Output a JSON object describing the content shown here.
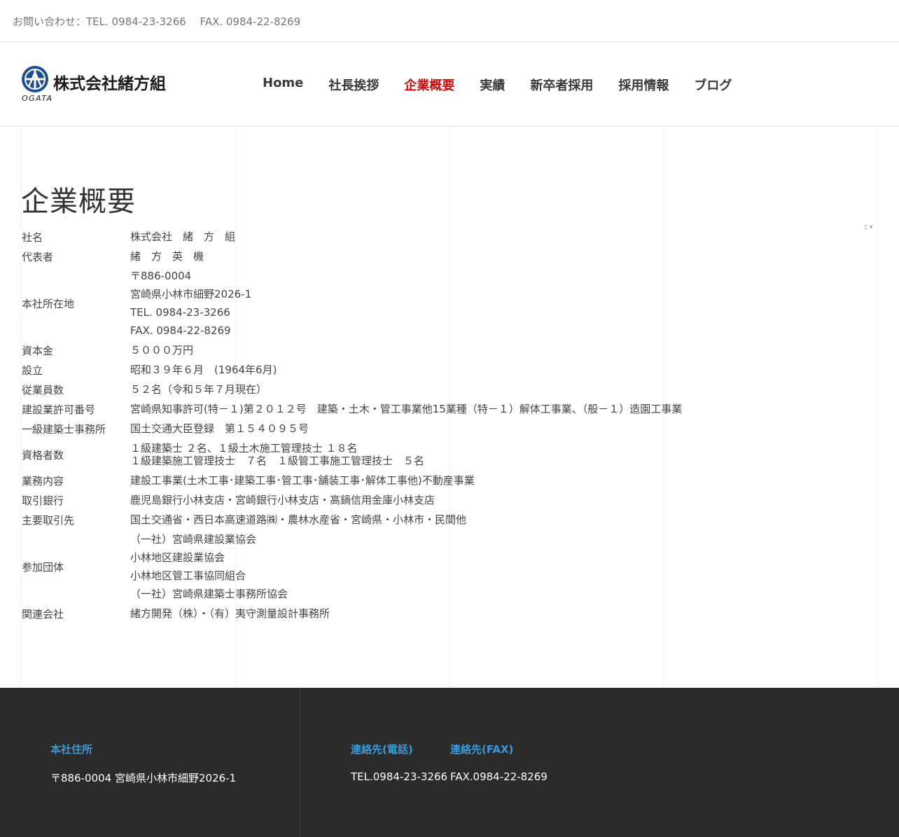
{
  "topbar": {
    "contact": "お問い合わせ：TEL. 0984-23-3266　 FAX. 0984-22-8269"
  },
  "header": {
    "logo_name": "株式会社緒方組",
    "logo_sub": "OGATA",
    "nav": [
      {
        "label": "Home",
        "active": false
      },
      {
        "label": "社長挨拶",
        "active": false
      },
      {
        "label": "企業概要",
        "active": true
      },
      {
        "label": "実績",
        "active": false
      },
      {
        "label": "新卒者採用",
        "active": false
      },
      {
        "label": "採用情報",
        "active": false
      },
      {
        "label": "ブログ",
        "active": false
      }
    ]
  },
  "main": {
    "title": "企業概要",
    "lang_switch": "▯ ▾",
    "rows": [
      {
        "label": "社名",
        "lines": [
          "株式会社　緒　方　組"
        ]
      },
      {
        "label": "代表者",
        "lines": [
          "緒　方　英　機"
        ]
      },
      {
        "label": "本社所在地",
        "lines": [
          "〒886-0004",
          "宮崎県小林市細野2026-1",
          "TEL. 0984-23-3266",
          "FAX. 0984-22-8269"
        ]
      },
      {
        "label": "資本金",
        "lines": [
          "５０００万円"
        ]
      },
      {
        "label": "設立",
        "lines": [
          "昭和３９年６月　(1964年6月)"
        ]
      },
      {
        "label": "従業員数",
        "lines": [
          "５２名（令和５年７月現在）"
        ]
      },
      {
        "label": "建設業許可番号",
        "lines": [
          "宮崎県知事許可(特－１)第２０１２号　建築・土木・管工事業他15業種（特－１）解体工事業、（般－１）造園工事業"
        ]
      },
      {
        "label": "一級建築士事務所",
        "lines": [
          "国土交通大臣登録　第１５４０９５号"
        ]
      },
      {
        "label": "資格者数",
        "lines": [
          "１級建築士 ２名、１級土木施工管理技士 １８名",
          "１級建築施工管理技士　７名　１級管工事施工管理技士　５名"
        ]
      },
      {
        "label": "業務内容",
        "lines": [
          "建設工事業(土木工事･建築工事･管工事･舗装工事･解体工事他)不動産事業"
        ]
      },
      {
        "label": "取引銀行",
        "lines": [
          "鹿児島銀行小林支店・宮崎銀行小林支店・高鍋信用金庫小林支店"
        ]
      },
      {
        "label": "主要取引先",
        "lines": [
          "国土交通省・西日本高速道路㈱・農林水産省・宮崎県・小林市・民間他"
        ]
      },
      {
        "label": "参加団体",
        "lines": [
          "（一社）宮崎県建設業協会",
          "小林地区建設業協会",
          "小林地区管工事協同組合",
          "（一社）宮崎県建築士事務所協会"
        ]
      },
      {
        "label": "関連会社",
        "lines": [
          "緒方開発（株）・（有）夷守測量設計事務所"
        ]
      }
    ]
  },
  "footer": {
    "address_heading": "本社住所",
    "address": "〒886-0004 宮崎県小林市細野2026-1",
    "tel_heading": "連絡先(電話)",
    "tel": "TEL.0984-23-3266",
    "fax_heading": "連絡先(FAX)",
    "fax": "FAX.0984-22-8269"
  },
  "colors": {
    "accent": "#c40a0a",
    "footer_bg": "#2b2b2b",
    "footer_heading": "#3a9ad9"
  }
}
